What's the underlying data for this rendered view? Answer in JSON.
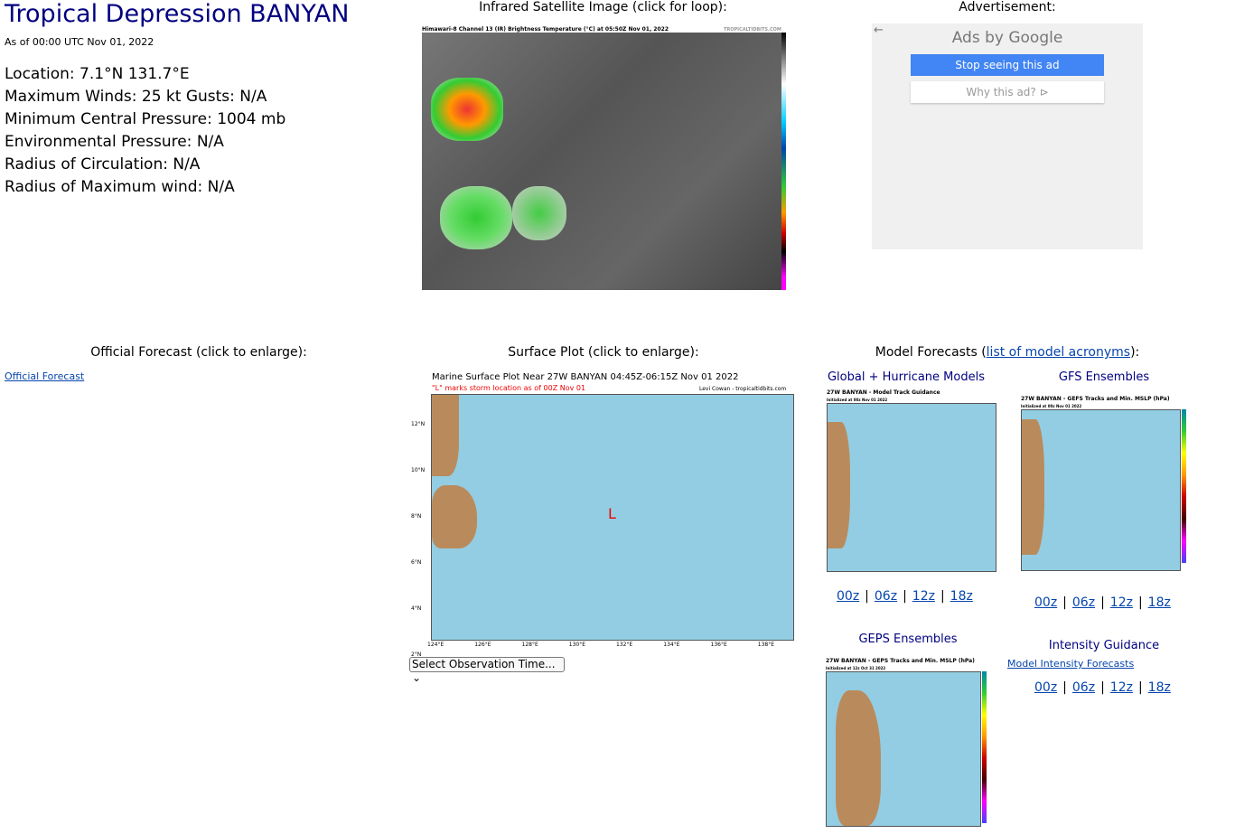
{
  "storm": {
    "title": "Tropical Depression BANYAN",
    "as_of": "As of 00:00 UTC Nov 01, 2022",
    "details": [
      "Location: 7.1°N 131.7°E",
      "Maximum Winds: 25 kt  Gusts: N/A",
      "Minimum Central Pressure: 1004 mb",
      "Environmental Pressure: N/A",
      "Radius of Circulation: N/A",
      "Radius of Maximum wind: N/A"
    ]
  },
  "satellite": {
    "heading": "Infrared Satellite Image (click for loop):",
    "image_title": "Himawari-8 Channel 13 (IR) Brightness Temperature (°C) at 05:50Z Nov 01, 2022",
    "credit": "TROPICALTIDBITS.COM"
  },
  "ad": {
    "heading": "Advertisement:",
    "ads_by": "Ads by Google",
    "stop": "Stop seeing this ad",
    "why": "Why this ad? ⊳"
  },
  "official": {
    "heading": "Official Forecast (click to enlarge):",
    "link": "Official Forecast"
  },
  "surface": {
    "heading": "Surface Plot (click to enlarge):",
    "image_title": "Marine Surface Plot Near 27W BANYAN 04:45Z-06:15Z Nov 01 2022",
    "note": "\"L\" marks storm location as of 00Z Nov 01",
    "credit": "Levi Cowan - tropicaltidbits.com",
    "marker": "L",
    "lat_labels": [
      "12°N",
      "10°N",
      "8°N",
      "6°N",
      "4°N",
      "2°N"
    ],
    "lon_labels": [
      "124°E",
      "126°E",
      "128°E",
      "130°E",
      "132°E",
      "134°E",
      "136°E",
      "138°E"
    ],
    "select": "Select Observation Time..."
  },
  "models": {
    "heading_pre": "Model Forecasts (",
    "heading_link": "list of model acronyms",
    "heading_post": "):",
    "global": {
      "heading": "Global + Hurricane Models",
      "image_title": "27W BANYAN - Model Track Guidance",
      "init": "Initialized at 00z Nov 01 2022",
      "runs": [
        "00z",
        "06z",
        "12z",
        "18z"
      ]
    },
    "gefs": {
      "heading": "GFS Ensembles",
      "image_title": "27W BANYAN - GEFS Tracks and Min. MSLP (hPa)",
      "init": "Initialized at 00z Nov 01 2022",
      "runs": [
        "00z",
        "06z",
        "12z",
        "18z"
      ]
    },
    "geps": {
      "heading": "GEPS Ensembles",
      "image_title": "27W BANYAN - GEPS Tracks and Min. MSLP (hPa)",
      "init": "Initialized at 12z Oct 31 2022"
    },
    "intensity": {
      "heading": "Intensity Guidance",
      "link": "Model Intensity Forecasts",
      "runs": [
        "00z",
        "06z",
        "12z",
        "18z"
      ]
    }
  }
}
